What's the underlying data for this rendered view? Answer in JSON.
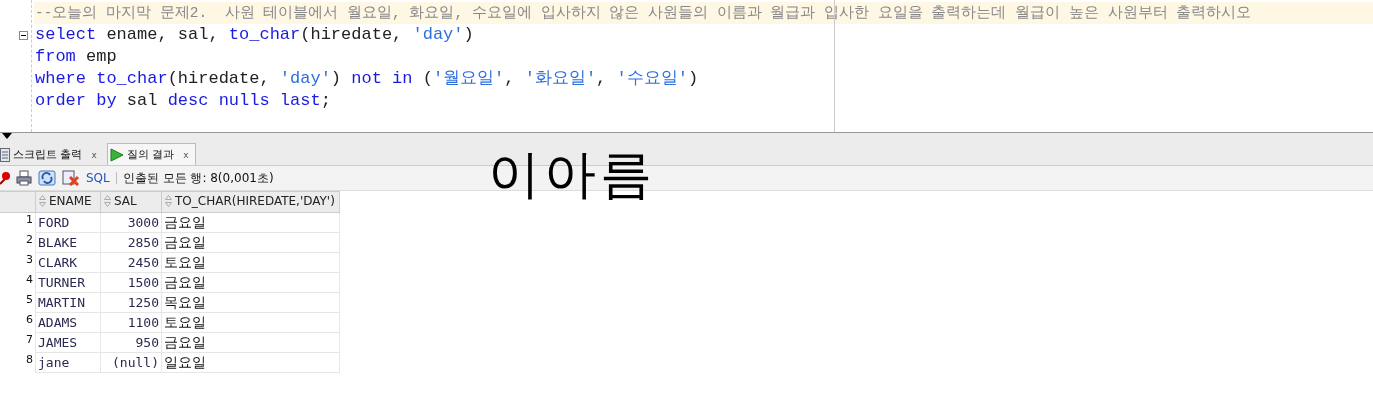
{
  "editor": {
    "lines": [
      {
        "current": true,
        "foldable": false,
        "tokens": [
          {
            "kind": "comment",
            "text": "--오늘의 마지막 문제2.  사원 테이블에서 월요일, 화요일, 수요일에 입사하지 않은 사원들의 이름과 월급과 입사한 요일을 출력하는데 월급이 높은 사원부터 출력하시오"
          }
        ]
      },
      {
        "current": false,
        "foldable": true,
        "tokens": [
          {
            "kind": "keyword",
            "text": "select"
          },
          {
            "kind": "plain",
            "text": " ename, sal, "
          },
          {
            "kind": "keyword",
            "text": "to_char"
          },
          {
            "kind": "plain",
            "text": "(hiredate, "
          },
          {
            "kind": "string",
            "text": "'day'"
          },
          {
            "kind": "plain",
            "text": ")"
          }
        ]
      },
      {
        "current": false,
        "foldable": false,
        "tokens": [
          {
            "kind": "keyword",
            "text": "from"
          },
          {
            "kind": "plain",
            "text": " emp"
          }
        ]
      },
      {
        "current": false,
        "foldable": false,
        "tokens": [
          {
            "kind": "keyword",
            "text": "where to_char"
          },
          {
            "kind": "plain",
            "text": "(hiredate, "
          },
          {
            "kind": "string",
            "text": "'day'"
          },
          {
            "kind": "plain",
            "text": ") "
          },
          {
            "kind": "keyword",
            "text": "not in"
          },
          {
            "kind": "plain",
            "text": " ("
          },
          {
            "kind": "string",
            "text": "'월요일'"
          },
          {
            "kind": "plain",
            "text": ", "
          },
          {
            "kind": "string",
            "text": "'화요일'"
          },
          {
            "kind": "plain",
            "text": ", "
          },
          {
            "kind": "string",
            "text": "'수요일'"
          },
          {
            "kind": "plain",
            "text": ")"
          }
        ]
      },
      {
        "current": false,
        "foldable": false,
        "tokens": [
          {
            "kind": "keyword",
            "text": "order by"
          },
          {
            "kind": "plain",
            "text": " sal "
          },
          {
            "kind": "keyword",
            "text": "desc nulls last"
          },
          {
            "kind": "plain",
            "text": ";"
          }
        ]
      }
    ]
  },
  "tabs": [
    {
      "kind": "script",
      "label": "스크립트 출력",
      "close": "x",
      "selected": false
    },
    {
      "kind": "query",
      "label": "질의 결과",
      "close": "x",
      "selected": true
    }
  ],
  "toolbar": {
    "sql_link": "SQL",
    "status": "인출된 모든 행: 8(0,001초)"
  },
  "annotation": "이아름",
  "table": {
    "columns": [
      "ENAME",
      "SAL",
      "TO_CHAR(HIREDATE,'DAY')"
    ],
    "rows": [
      {
        "num": "1",
        "cells": [
          "FORD",
          "3000",
          "금요일"
        ]
      },
      {
        "num": "2",
        "cells": [
          "BLAKE",
          "2850",
          "금요일"
        ]
      },
      {
        "num": "3",
        "cells": [
          "CLARK",
          "2450",
          "토요일"
        ]
      },
      {
        "num": "4",
        "cells": [
          "TURNER",
          "1500",
          "금요일"
        ]
      },
      {
        "num": "5",
        "cells": [
          "MARTIN",
          "1250",
          "목요일"
        ]
      },
      {
        "num": "6",
        "cells": [
          "ADAMS",
          "1100",
          "토요일"
        ]
      },
      {
        "num": "7",
        "cells": [
          "JAMES",
          "950",
          "금요일"
        ]
      },
      {
        "num": "8",
        "cells": [
          "jane",
          "(null)",
          "일요일"
        ]
      }
    ]
  }
}
